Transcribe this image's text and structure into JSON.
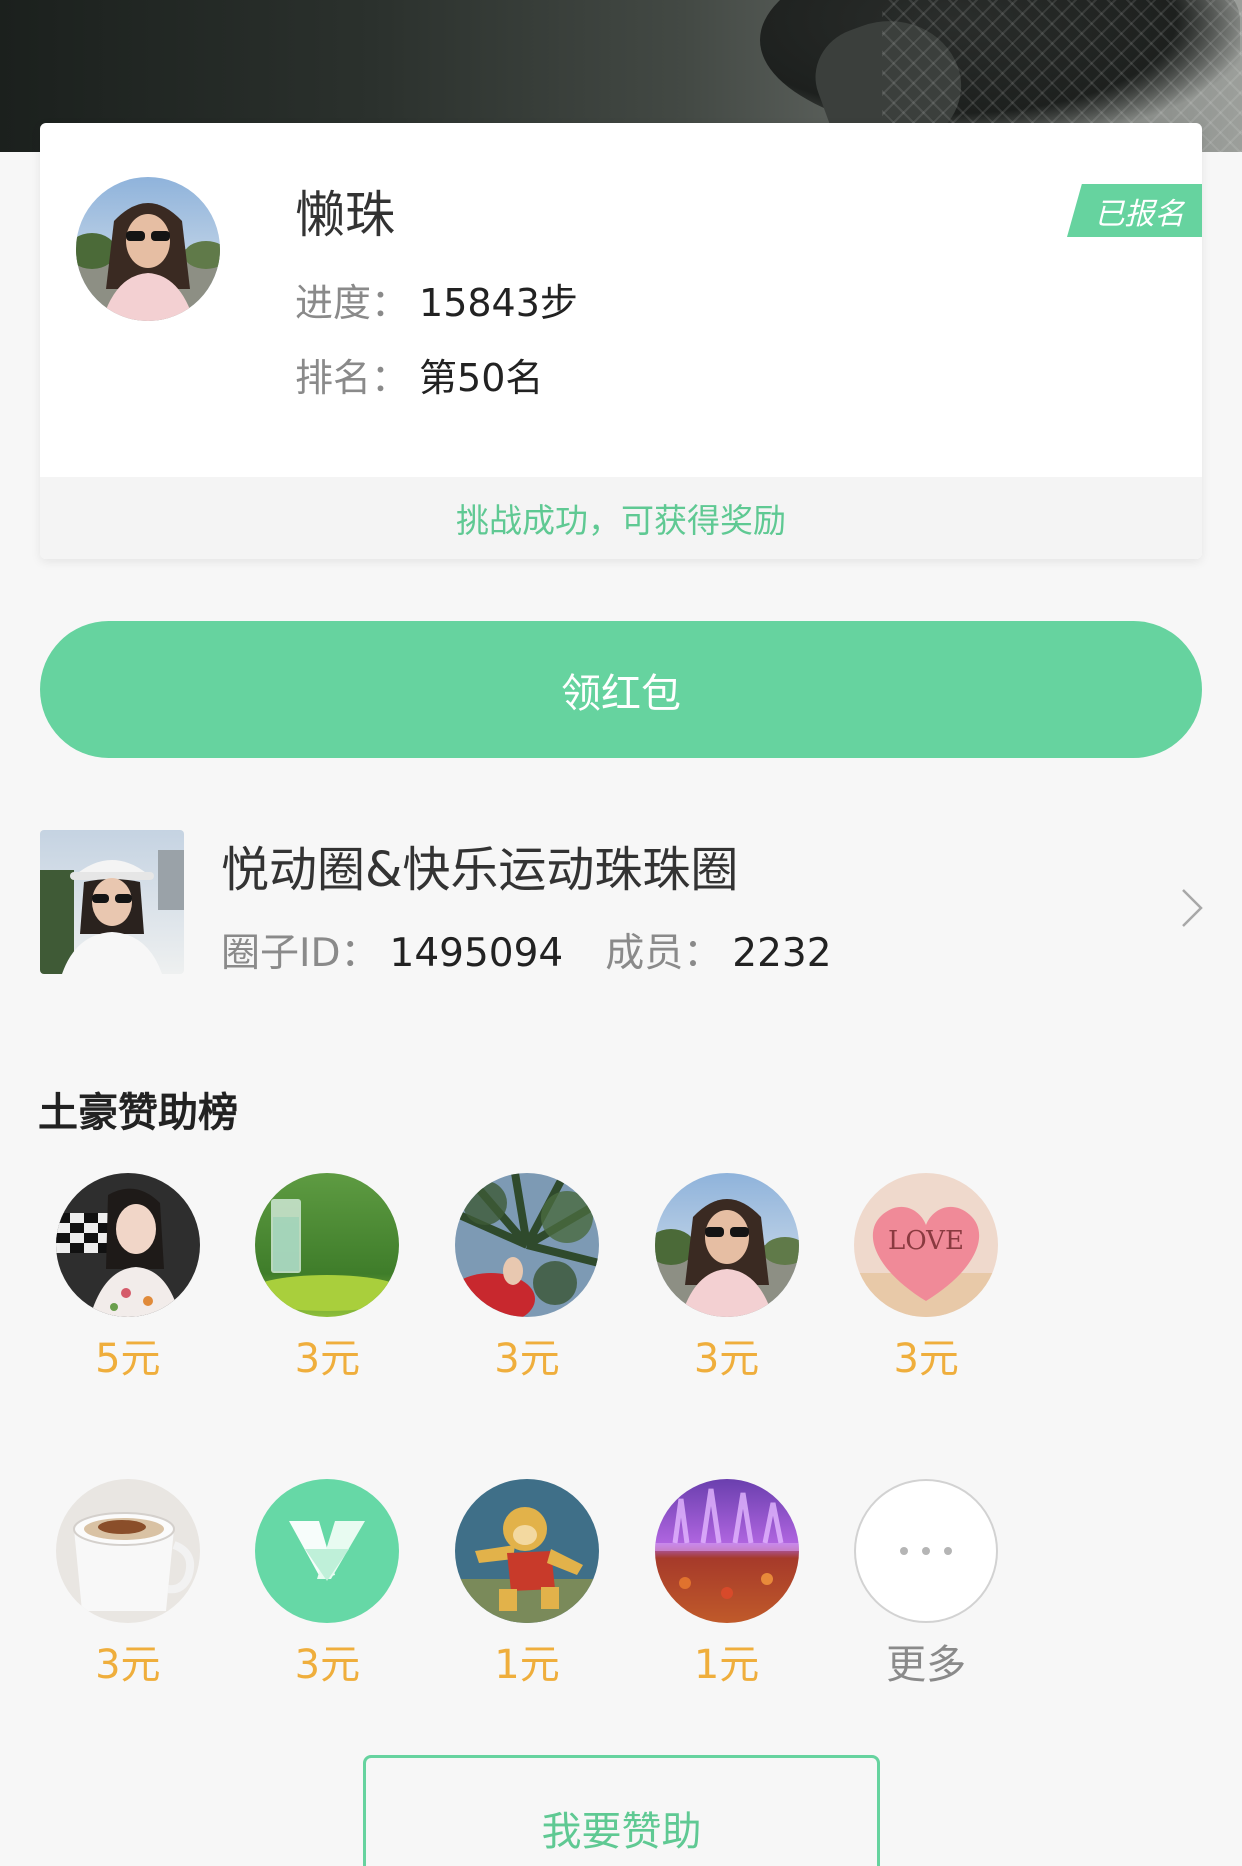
{
  "profile": {
    "name": "懒珠",
    "badge": "已报名",
    "progress_label": "进度：",
    "progress_value": "15843步",
    "rank_label": "排名：",
    "rank_value": "第50名",
    "status": "挑战成功，可获得奖励"
  },
  "claim_button": "领红包",
  "circle": {
    "name": "悦动圈&快乐运动珠珠圈",
    "id_label": "圈子ID：",
    "id_value": "1495094",
    "members_label": "成员：",
    "members_value": "2232"
  },
  "sponsors": {
    "title": "土豪赞助榜",
    "items": [
      {
        "amount": "5元"
      },
      {
        "amount": "3元"
      },
      {
        "amount": "3元"
      },
      {
        "amount": "3元"
      },
      {
        "amount": "3元",
        "avatar_text": "LOVE"
      },
      {
        "amount": "3元"
      },
      {
        "amount": "3元"
      },
      {
        "amount": "1元"
      },
      {
        "amount": "1元"
      }
    ],
    "more_label": "更多"
  },
  "sponsor_button": "我要赞助",
  "icons": {
    "chevron": "chevron-right-icon",
    "more": "more-dots-icon"
  },
  "colors": {
    "accent_green": "#66d39f",
    "text_green": "#5fc993",
    "amount_orange": "#efae3c",
    "background": "#f7f7f7"
  }
}
